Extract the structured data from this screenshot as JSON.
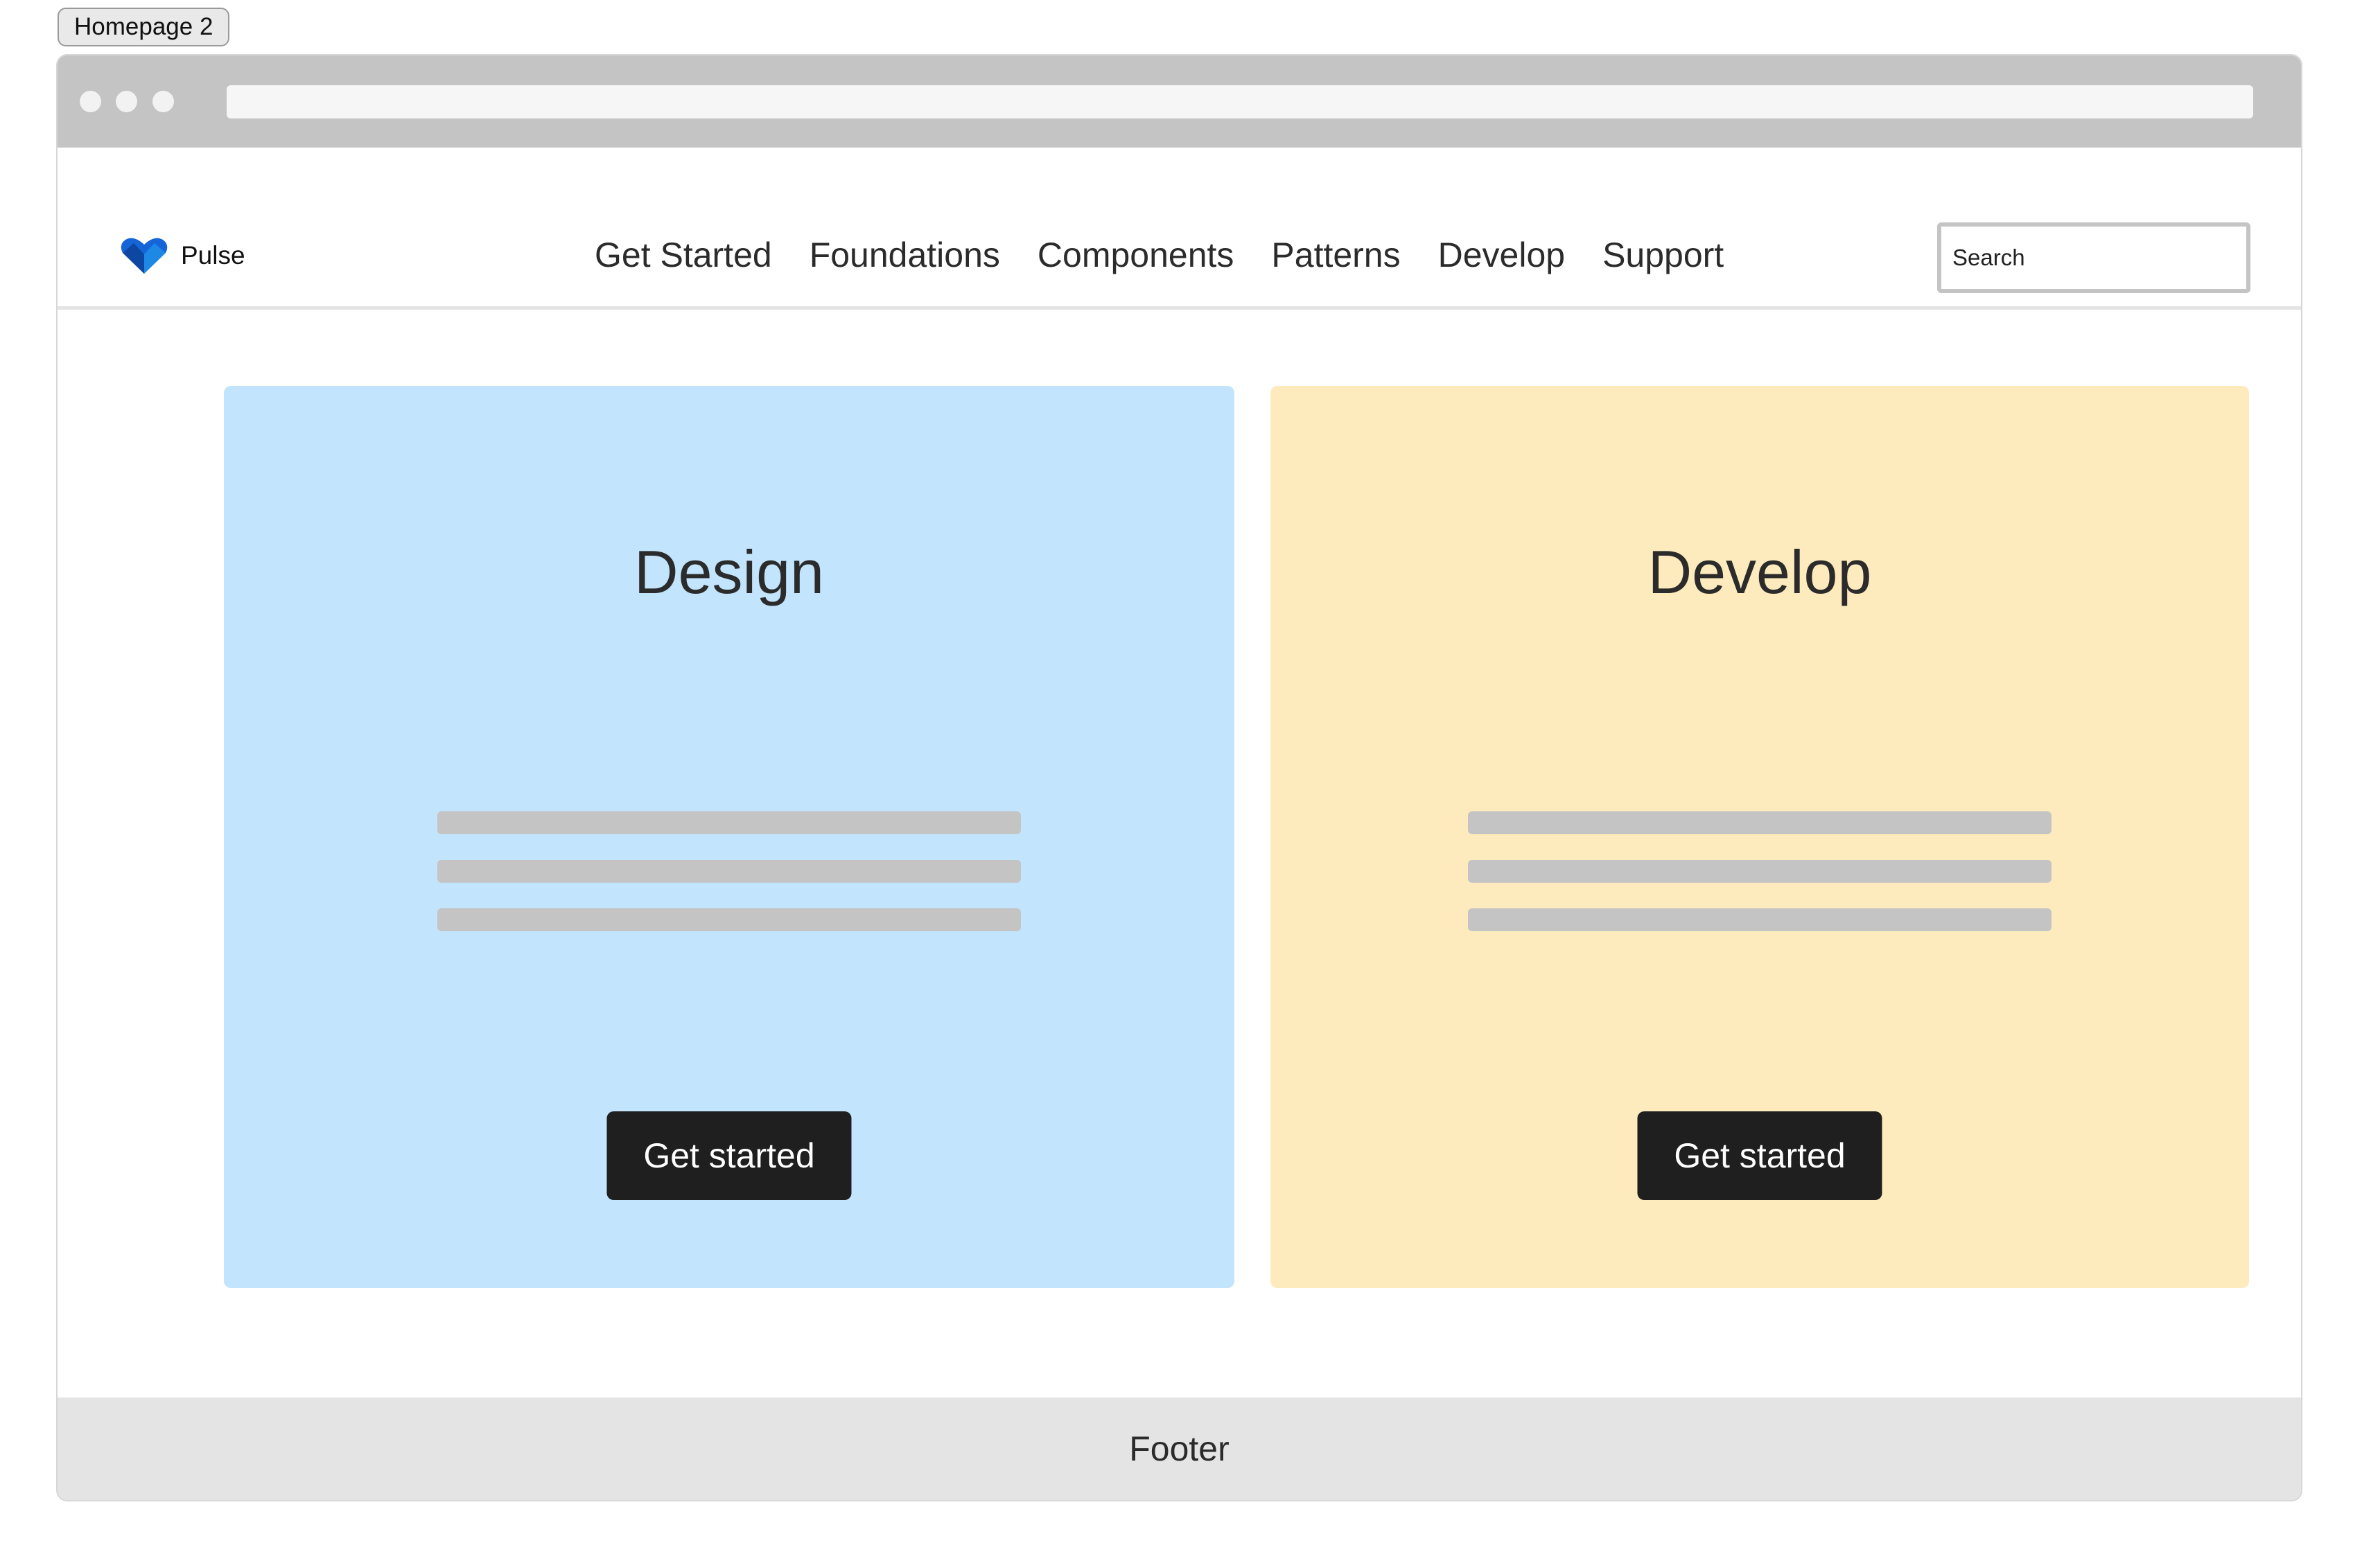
{
  "page_tab": {
    "label": "Homepage 2"
  },
  "brand": {
    "name": "Pulse",
    "icon": "heart-logo-icon",
    "color": "#1565d8"
  },
  "nav": {
    "items": [
      {
        "label": "Get Started"
      },
      {
        "label": "Foundations"
      },
      {
        "label": "Components"
      },
      {
        "label": "Patterns"
      },
      {
        "label": "Develop"
      },
      {
        "label": "Support"
      }
    ]
  },
  "search": {
    "placeholder": "Search",
    "value": ""
  },
  "cards": [
    {
      "title": "Design",
      "button_label": "Get started",
      "background": "#c2e4fc"
    },
    {
      "title": "Develop",
      "button_label": "Get started",
      "background": "#feebbd"
    }
  ],
  "footer": {
    "label": "Footer"
  }
}
